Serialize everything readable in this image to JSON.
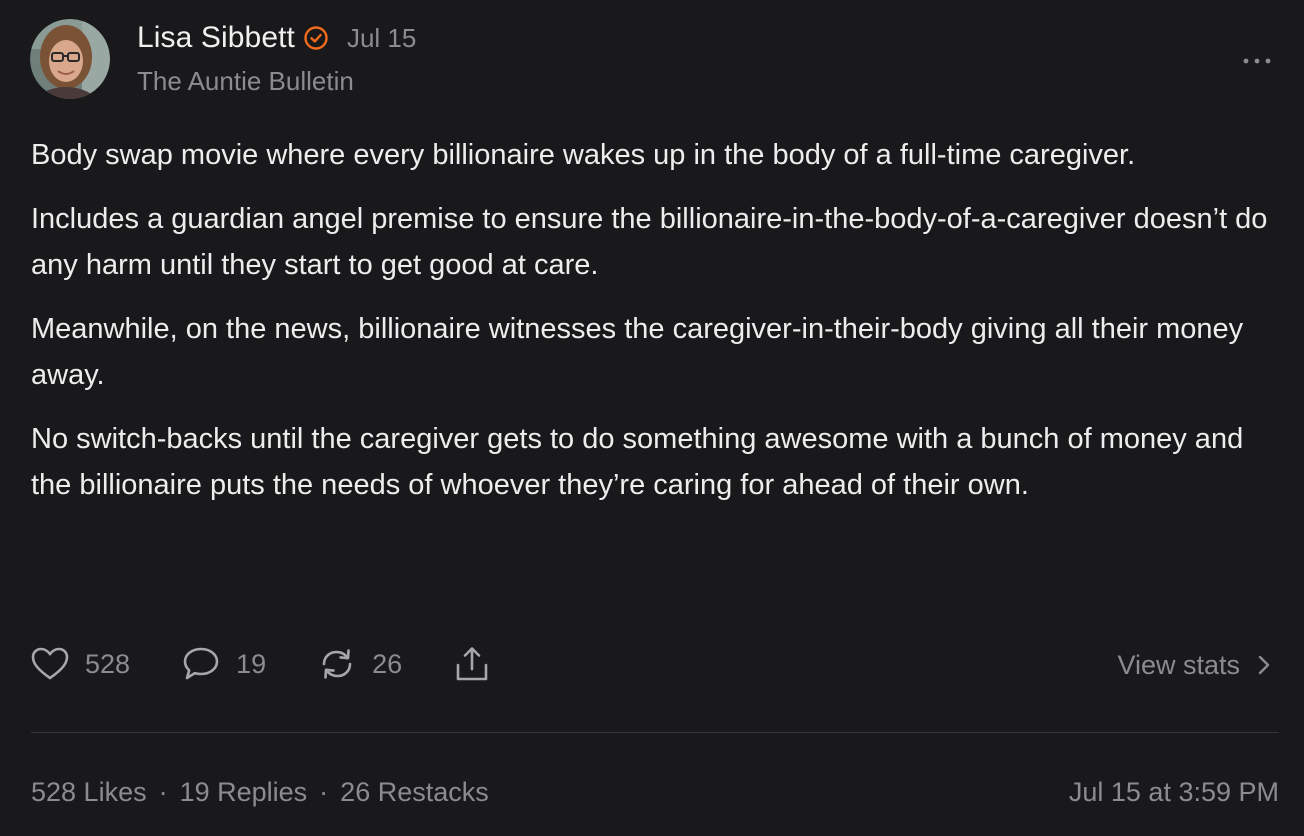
{
  "author": {
    "name": "Lisa Sibbett",
    "verified_color": "#f26b1d",
    "date": "Jul 15",
    "publication": "The Auntie Bulletin"
  },
  "body": {
    "paragraphs": [
      "Body swap movie where every billionaire wakes up in the body of a full-time caregiver.",
      "Includes a guardian angel premise to ensure the billionaire-in-the-body-of-a-caregiver doesn’t do any harm until they start to get good at care.",
      "Meanwhile, on the news, billionaire witnesses the caregiver-in-their-body giving all their money away.",
      "No switch-backs until the caregiver gets to do something awesome with a bunch of money and the billionaire puts the needs of whoever they’re caring for ahead of their own."
    ]
  },
  "actions": {
    "likes": "528",
    "replies": "19",
    "restacks": "26",
    "view_stats": "View stats"
  },
  "footer": {
    "likes": "528 Likes",
    "replies": "19 Replies",
    "restacks": "26 Restacks",
    "separator": "·",
    "timestamp": "Jul 15 at 3:59 PM"
  },
  "icons": {
    "like": "heart-icon",
    "reply": "comment-icon",
    "restack": "restack-icon",
    "share": "share-icon",
    "more": "more-icon",
    "chevron": "chevron-right-icon",
    "verified": "verified-badge-icon"
  }
}
